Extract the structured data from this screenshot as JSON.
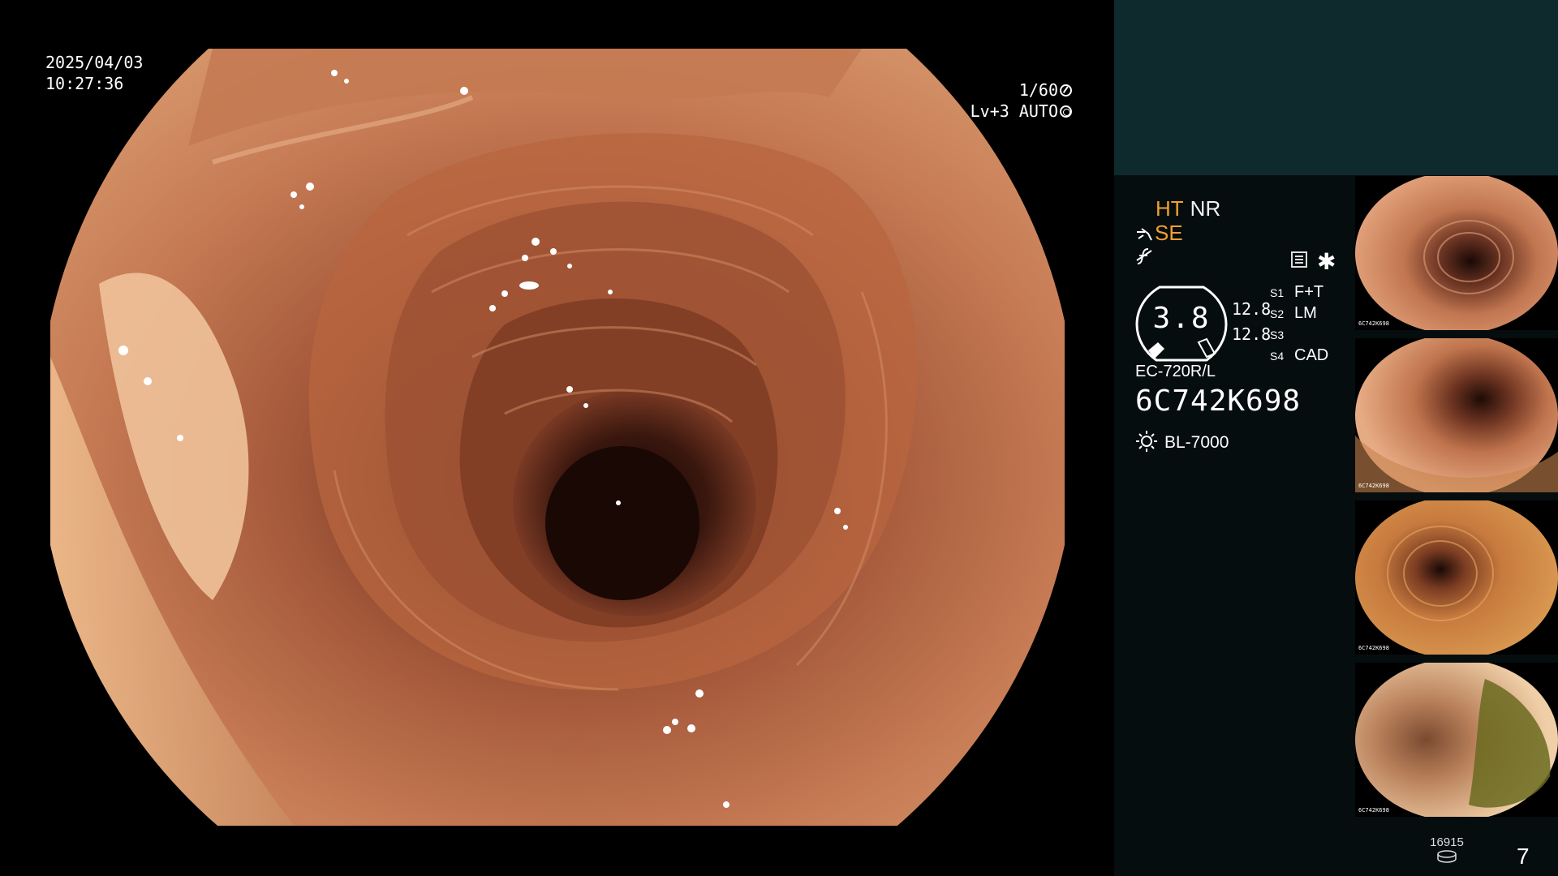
{
  "osd": {
    "date": "2025/04/03",
    "time": "10:27:36",
    "shutter": "1/60",
    "level": "Lv+3 AUTO"
  },
  "panel": {
    "mode_ht": "HT",
    "mode_nr": "NR",
    "mode_se": "SE",
    "gauge_value": "3.8",
    "gauge_right_top": "12.8",
    "gauge_right_bottom": "12.8",
    "switches": [
      {
        "key": "S1",
        "value": "F+T"
      },
      {
        "key": "S2",
        "value": "LM"
      },
      {
        "key": "S3",
        "value": ""
      },
      {
        "key": "S4",
        "value": "CAD"
      }
    ],
    "scope_model": "EC-720R/L",
    "scope_serial": "6C742K698",
    "light_source": "BL-7000",
    "record_count": "16915",
    "page_number": "7"
  },
  "thumbnails": [
    {
      "label": "6C742K698"
    },
    {
      "label": "6C742K698"
    },
    {
      "label": "6C742K698"
    },
    {
      "label": "6C742K698"
    }
  ],
  "icons": [
    "shutter-icon",
    "auto-icon",
    "hook-icon",
    "f-icon",
    "screen-icon",
    "star-icon",
    "sun-icon",
    "disk-icon"
  ],
  "colors": {
    "panel_top": "#0f2a2c",
    "panel_bg": "#060d0e",
    "accent_orange": "#f0a030",
    "mucosa": "#c07a52"
  }
}
